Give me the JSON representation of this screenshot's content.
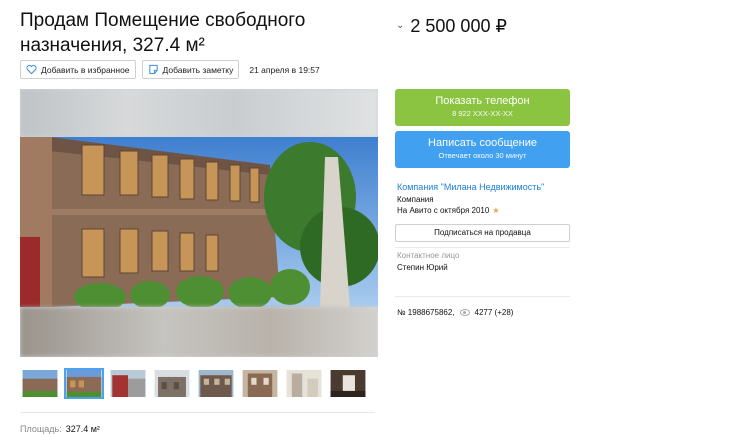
{
  "listing": {
    "title": "Продам Помещение свободного назначения, 327.4 м²",
    "price": "2 500 000 ₽",
    "date": "21 апреля в 19:57",
    "id_text": "№ 1988675862,",
    "views": "4277 (+28)",
    "area_label": "Площадь:",
    "area_value": "327.4 м²"
  },
  "actions": {
    "favorite": "Добавить в избранное",
    "note": "Добавить заметку"
  },
  "contact": {
    "phone_label": "Показать телефон",
    "phone_masked": "8 922 XXX-XX-XX",
    "message_label": "Написать сообщение",
    "message_sub": "Отвечает около 30 минут",
    "company_name": "Компания \"Милана Недвижимость\"",
    "company_type": "Компания",
    "on_avito_since": "На Авито с октября 2010",
    "subscribe_label": "Подписаться на продавца",
    "person_label": "Контактное лицо",
    "person_name": "Степин Юрий"
  },
  "colors": {
    "phone_button": "#8bc441",
    "message_button": "#41a1f0",
    "link": "#1a7fd9"
  },
  "gallery": {
    "thumb_count": 8,
    "active_thumb": 2
  }
}
